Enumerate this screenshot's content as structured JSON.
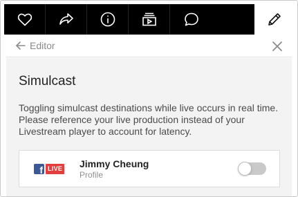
{
  "toolbar": {
    "buttons": [
      {
        "icon": "heart-icon"
      },
      {
        "icon": "share-icon"
      },
      {
        "icon": "info-icon"
      },
      {
        "icon": "playlist-icon"
      },
      {
        "icon": "chat-icon"
      }
    ],
    "edit_icon": "pencil-icon"
  },
  "editor": {
    "back_label": "Editor",
    "close_icon": "close-icon"
  },
  "simulcast": {
    "title": "Simulcast",
    "description": "Toggling simulcast destinations while live occurs in real time. Please reference your live production instead of your Livestream player to account for latency.",
    "destinations": [
      {
        "service_logo": "facebook-icon",
        "badge": "LIVE",
        "name": "Jimmy Cheung",
        "type": "Profile",
        "enabled": false
      }
    ]
  },
  "colors": {
    "toolbar_bg": "#000000",
    "panel_bg": "#f3f3f3",
    "facebook": "#3b5998",
    "live_badge": "#e33e3e",
    "toggle_off": "#c9c9c9"
  }
}
